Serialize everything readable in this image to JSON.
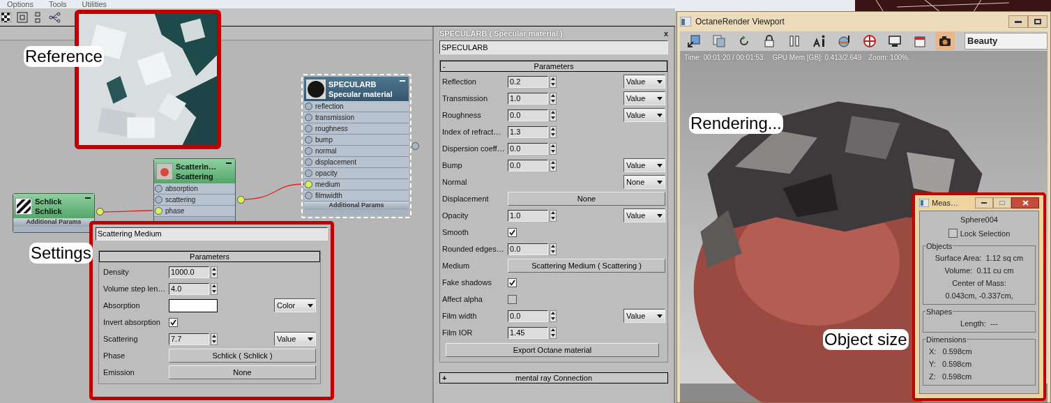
{
  "menu": [
    "Options",
    "Tools",
    "Utilities"
  ],
  "nodes": [
    {
      "kind": "texture",
      "title": "Schlick",
      "subtitle": "Schlick",
      "selected": false,
      "footer": "Additional Params"
    },
    {
      "kind": "medium",
      "title": "Scatterin…",
      "subtitle": "Scattering",
      "selected": false,
      "sockets": [
        {
          "label": "absorption",
          "connected": false
        },
        {
          "label": "scattering",
          "connected": false
        },
        {
          "label": "phase",
          "connected": true
        }
      ]
    },
    {
      "kind": "material",
      "title": "SPECULARB",
      "subtitle": "Specular material",
      "selected": true,
      "sockets": [
        {
          "label": "reflection",
          "connected": false
        },
        {
          "label": "transmission",
          "connected": false
        },
        {
          "label": "roughness",
          "connected": false
        },
        {
          "label": "bump",
          "connected": false
        },
        {
          "label": "normal",
          "connected": false
        },
        {
          "label": "displacement",
          "connected": false
        },
        {
          "label": "opacity",
          "connected": false
        },
        {
          "label": "medium",
          "connected": true
        },
        {
          "label": "filmwidth",
          "connected": false
        }
      ],
      "footer": "Additional Params"
    }
  ],
  "scattering_editor": {
    "name": "Scattering Medium",
    "rollout": "Parameters",
    "rows": [
      {
        "kind": "spinner",
        "label": "Density",
        "value": "1000.0"
      },
      {
        "kind": "spinner",
        "label": "Volume step len…",
        "value": "4.0"
      },
      {
        "kind": "color",
        "label": "Absorption",
        "color": "#ffffff",
        "dropdown": "Color"
      },
      {
        "kind": "checkbox",
        "label": "Invert absorption",
        "checked": true
      },
      {
        "kind": "spinner",
        "label": "Scattering",
        "value": "7.7",
        "dropdown": "Value"
      },
      {
        "kind": "button",
        "label": "Phase",
        "value": "Schlick  ( Schlick )"
      },
      {
        "kind": "button",
        "label": "Emission",
        "value": "None"
      }
    ]
  },
  "material_panel": {
    "title": "SPECULARB  ( Specular material )",
    "close": "x",
    "name": "SPECULARB",
    "rollout": {
      "sign": "-",
      "title": "Parameters"
    },
    "rows": [
      {
        "kind": "spinner",
        "label": "Reflection",
        "value": "0.2",
        "dropdown": "Value"
      },
      {
        "kind": "spinner",
        "label": "Transmission",
        "value": "1.0",
        "dropdown": "Value"
      },
      {
        "kind": "spinner",
        "label": "Roughness",
        "value": "0.0",
        "dropdown": "Value"
      },
      {
        "kind": "spinner",
        "label": "Index of refract…",
        "value": "1.3"
      },
      {
        "kind": "spinner",
        "label": "Dispersion coeff…",
        "value": "0.0"
      },
      {
        "kind": "spinner",
        "label": "Bump",
        "value": "0.0",
        "dropdown": "Value"
      },
      {
        "kind": "dropdown",
        "label": "Normal",
        "dropdown": "None"
      },
      {
        "kind": "button",
        "label": "Displacement",
        "value": "None"
      },
      {
        "kind": "spinner",
        "label": "Opacity",
        "value": "1.0",
        "dropdown": "Value"
      },
      {
        "kind": "checkbox",
        "label": "Smooth",
        "checked": true
      },
      {
        "kind": "spinner",
        "label": "Rounded edges…",
        "value": "0.0"
      },
      {
        "kind": "button",
        "label": "Medium",
        "value": "Scattering Medium  ( Scattering )"
      },
      {
        "kind": "checkbox",
        "label": "Fake shadows",
        "checked": true
      },
      {
        "kind": "checkbox",
        "label": "Affect alpha",
        "checked": false
      },
      {
        "kind": "spinner",
        "label": "Film width",
        "value": "0.0",
        "dropdown": "Value"
      },
      {
        "kind": "spinner",
        "label": "Film IOR",
        "value": "1.45"
      }
    ],
    "export_button": "Export Octane material",
    "collapsed_rollout": {
      "sign": "+",
      "title": "mental ray Connection"
    }
  },
  "viewport": {
    "title": "OctaneRender Viewport",
    "toolbar": [
      {
        "selected": false
      },
      {
        "selected": false
      },
      {
        "selected": false
      },
      {
        "selected": false
      },
      {
        "selected": false
      },
      {
        "selected": false
      },
      {
        "selected": false
      },
      {
        "selected": false
      },
      {
        "selected": false
      },
      {
        "selected": false
      },
      {
        "selected": true
      }
    ],
    "pass": "Beauty",
    "status": [
      "Time: 00:01:20 / 00:01:53.",
      "GPU Mem [GB]: 0.413/2.649",
      "Zoom: 100%."
    ]
  },
  "measure": {
    "title": "Meas…",
    "object": "Sphere004",
    "lock": {
      "label": "Lock Selection",
      "checked": false
    },
    "groups": [
      {
        "title": "Objects",
        "kind": "centered",
        "lines": [
          "Surface Area:  1.12 sq cm",
          "Volume:  0.11 cu cm",
          "Center of Mass:",
          "0.043cm, -0.337cm,"
        ]
      },
      {
        "title": "Shapes",
        "kind": "centered",
        "lines": [
          "Length:  ---"
        ]
      },
      {
        "title": "Dimensions",
        "kind": "list",
        "lines": [
          "X:   0.598cm",
          "Y:   0.598cm",
          "Z:   0.598cm"
        ]
      }
    ]
  },
  "callouts": [
    {
      "text": "Reference"
    },
    {
      "text": "Settings"
    },
    {
      "text": "Rendering..."
    },
    {
      "text": "Object size"
    }
  ]
}
